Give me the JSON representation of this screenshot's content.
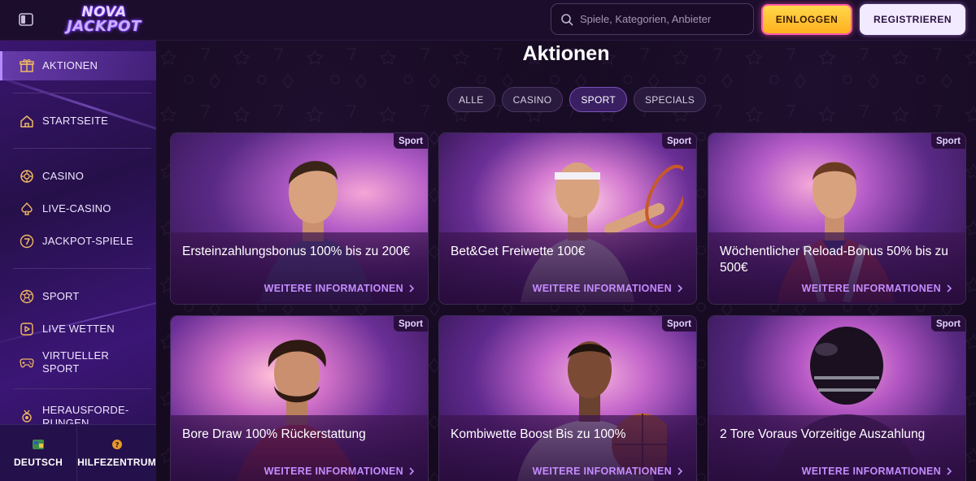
{
  "header": {
    "logo_top": "NOVA",
    "logo_bottom": "JACKPOT",
    "search_placeholder": "Spiele, Kategorien, Anbieter",
    "login_label": "EINLOGGEN",
    "register_label": "REGISTRIEREN"
  },
  "sidebar": {
    "items": [
      {
        "label": "AKTIONEN",
        "icon": "gift-shop-icon"
      },
      {
        "label": "STARTSEITE",
        "icon": "home-icon"
      },
      {
        "label": "CASINO",
        "icon": "casino-chip-icon"
      },
      {
        "label": "LIVE-CASINO",
        "icon": "spade-icon"
      },
      {
        "label": "JACKPOT-SPIELE",
        "icon": "seven-icon"
      },
      {
        "label": "SPORT",
        "icon": "ball-icon"
      },
      {
        "label": "LIVE WETTEN",
        "icon": "play-screen-icon"
      },
      {
        "label": "VIRTUELLER SPORT",
        "icon": "gamepad-icon"
      },
      {
        "label": "HERAUSFORDE-RUNGEN",
        "icon": "medal-icon"
      }
    ],
    "footer": {
      "language_label": "DEUTSCH",
      "help_label": "HILFEZENTRUM"
    }
  },
  "main": {
    "title": "Aktionen",
    "filters": [
      "ALLE",
      "CASINO",
      "SPORT",
      "SPECIALS"
    ],
    "active_filter": "SPORT",
    "cards": [
      {
        "tag": "Sport",
        "title": "Ersteinzahlungsbonus 100% bis zu 200€",
        "link": "WEITERE INFORMATIONEN"
      },
      {
        "tag": "Sport",
        "title": "Bet&Get Freiwette 100€",
        "link": "WEITERE INFORMATIONEN"
      },
      {
        "tag": "Sport",
        "title": "Wöchentlicher Reload-Bonus 50% bis zu 500€",
        "link": "WEITERE INFORMATIONEN"
      },
      {
        "tag": "Sport",
        "title": "Bore Draw 100% Rückerstattung",
        "link": "WEITERE INFORMATIONEN"
      },
      {
        "tag": "Sport",
        "title": "Kombiwette Boost Bis zu 100%",
        "link": "WEITERE INFORMATIONEN"
      },
      {
        "tag": "Sport",
        "title": "2 Tore Voraus Vorzeitige Auszahlung",
        "link": "WEITERE INFORMATIONEN"
      }
    ]
  },
  "colors": {
    "accent_purple": "#c48cff",
    "login_yellow": "#ffc531",
    "sidebar_bg": "#2e1458",
    "page_bg": "#150a20"
  }
}
